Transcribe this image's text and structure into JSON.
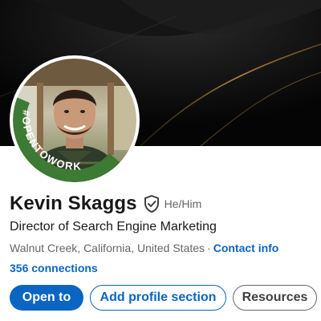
{
  "profile": {
    "name": "Kevin Skaggs",
    "verified_icon": "shield-check-icon",
    "pronouns": "He/Him",
    "headline": "Director of Search Engine Marketing",
    "location": "Walnut Creek, California, United States",
    "separator": "·",
    "contact_info": "Contact info",
    "connections": "356 connections",
    "open_to_work_badge": "#OPENTOWORK"
  },
  "actions": {
    "open_to": "Open to",
    "add_profile_section": "Add profile section",
    "resources": "Resources"
  },
  "colors": {
    "brand_blue": "#0a66c2",
    "open_to_work_green": "#3d7a33",
    "banner_black": "#050505",
    "banner_gold_line": "#b88a3a"
  }
}
